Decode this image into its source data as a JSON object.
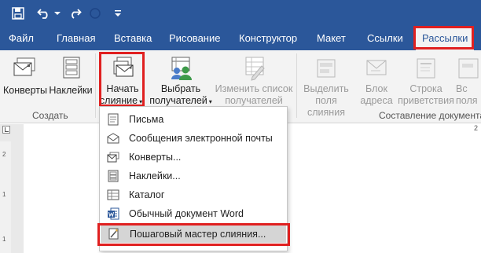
{
  "quick_access": {
    "icons": [
      "save-icon",
      "undo-icon",
      "dropdown-arrow-icon",
      "redo-icon",
      "touch-mode-icon",
      "customize-icon"
    ]
  },
  "tabs": [
    {
      "label": "Файл"
    },
    {
      "label": "Главная"
    },
    {
      "label": "Вставка"
    },
    {
      "label": "Рисование"
    },
    {
      "label": "Конструктор"
    },
    {
      "label": "Макет"
    },
    {
      "label": "Ссылки"
    },
    {
      "label": "Рассылки",
      "active": true
    }
  ],
  "ribbon": {
    "envelopes": "Конверты",
    "labels": "Наклейки",
    "group_create": "Создать",
    "start_merge_line1": "Начать",
    "start_merge_line2": "слияние",
    "select_recipients_line1": "Выбрать",
    "select_recipients_line2": "получателей",
    "edit_list_line1": "Изменить список",
    "edit_list_line2": "получателей",
    "highlight_fields_line1": "Выделить",
    "highlight_fields_line2": "поля слияния",
    "address_block_line1": "Блок",
    "address_block_line2": "адреса",
    "greeting_line1": "Строка",
    "greeting_line2": "приветствия",
    "insert_field_line1": "Вс",
    "insert_field_line2": "поля",
    "group_compose": "Составление документа"
  },
  "dropdown": {
    "items": [
      {
        "label": "Письма",
        "icon": "letter-icon"
      },
      {
        "label": "Сообщения электронной почты",
        "icon": "email-icon"
      },
      {
        "label": "Конверты...",
        "icon": "envelope-icon"
      },
      {
        "label": "Наклейки...",
        "icon": "labels-icon"
      },
      {
        "label": "Каталог",
        "icon": "directory-icon"
      },
      {
        "label": "Обычный документ Word",
        "icon": "word-document-icon"
      },
      {
        "label": "Пошаговый мастер слияния...",
        "icon": "wizard-icon",
        "highlighted": true
      }
    ]
  },
  "ruler": {
    "numbers": [
      "2",
      "1",
      "1"
    ],
    "right_number": "2"
  },
  "colors": {
    "title_bar": "#2b579a",
    "ribbon": "#f3f3f3",
    "highlight_box": "#e02020"
  }
}
